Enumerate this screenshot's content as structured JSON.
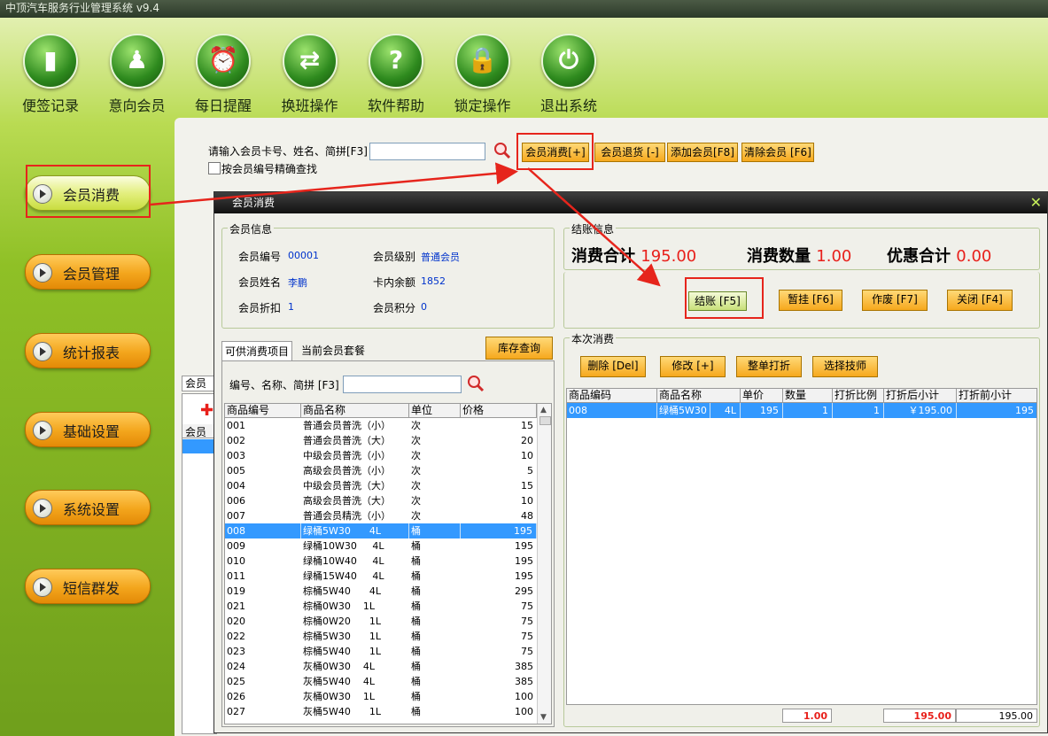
{
  "app_title": "中顶汽车服务行业管理系统 v9.4",
  "toolbar": [
    {
      "label": "便签记录",
      "icon": "note-icon",
      "glyph": "▮"
    },
    {
      "label": "意向会员",
      "icon": "person-icon",
      "glyph": "♟"
    },
    {
      "label": "每日提醒",
      "icon": "alarm-clock-icon",
      "glyph": "⏰"
    },
    {
      "label": "换班操作",
      "icon": "swap-arrows-icon",
      "glyph": "⇄"
    },
    {
      "label": "软件帮助",
      "icon": "help-icon",
      "glyph": "?"
    },
    {
      "label": "锁定操作",
      "icon": "lock-icon",
      "glyph": "🔒"
    },
    {
      "label": "退出系统",
      "icon": "power-icon",
      "glyph": "⏻"
    }
  ],
  "sidebar": [
    {
      "label": "会员消费",
      "active": true
    },
    {
      "label": "会员管理"
    },
    {
      "label": "统计报表"
    },
    {
      "label": "基础设置"
    },
    {
      "label": "系统设置"
    },
    {
      "label": "短信群发"
    }
  ],
  "search": {
    "prompt": "请输入会员卡号、姓名、简拼[F3]",
    "value": "",
    "exact_label": "按会员编号精确查找",
    "buttons": [
      "会员消费[+]",
      "会员退货 [-]",
      "添加会员[F8]",
      "清除会员 [F6]"
    ]
  },
  "behind": {
    "tab": "会员",
    "col": "会员编"
  },
  "dialog": {
    "title": "会员消费",
    "member_group": "会员信息",
    "member": {
      "id_label": "会员编号",
      "id": "00001",
      "level_label": "会员级别",
      "level": "普通会员",
      "name_label": "会员姓名",
      "name": "李鹏",
      "balance_label": "卡内余额",
      "balance": "1852",
      "discount_label": "会员折扣",
      "discount": "1",
      "points_label": "会员积分",
      "points": "0"
    },
    "checkout_group": "结账信息",
    "totals": {
      "total_label": "消费合计",
      "total": "195.00",
      "qty_label": "消费数量",
      "qty": "1.00",
      "discount_label": "优惠合计",
      "discount": "0.00"
    },
    "checkout_buttons": [
      "结账 [F5]",
      "暂挂 [F6]",
      "作废 [F7]",
      "关闭 [F4]"
    ],
    "tabs": [
      "可供消费项目",
      "当前会员套餐"
    ],
    "stock_button": "库存查询",
    "product_search_label": "编号、名称、简拼 [F3]",
    "product_columns": [
      "商品编号",
      "商品名称",
      "单位",
      "价格"
    ],
    "products": [
      {
        "code": "001",
        "name": "普通会员普洗（小）",
        "unit": "次",
        "price": "15"
      },
      {
        "code": "002",
        "name": "普通会员普洗（大）",
        "unit": "次",
        "price": "20"
      },
      {
        "code": "003",
        "name": "中级会员普洗（小）",
        "unit": "次",
        "price": "10"
      },
      {
        "code": "005",
        "name": "高级会员普洗（小）",
        "unit": "次",
        "price": "5"
      },
      {
        "code": "004",
        "name": "中级会员普洗（大）",
        "unit": "次",
        "price": "15"
      },
      {
        "code": "006",
        "name": "高级会员普洗（大）",
        "unit": "次",
        "price": "10"
      },
      {
        "code": "007",
        "name": "普通会员精洗（小）",
        "unit": "次",
        "price": "48"
      },
      {
        "code": "008",
        "name": "绿桶5W30      4L",
        "unit": "桶",
        "price": "195",
        "selected": true
      },
      {
        "code": "009",
        "name": "绿桶10W30     4L",
        "unit": "桶",
        "price": "195"
      },
      {
        "code": "010",
        "name": "绿桶10W40     4L",
        "unit": "桶",
        "price": "195"
      },
      {
        "code": "011",
        "name": "绿桶15W40     4L",
        "unit": "桶",
        "price": "195"
      },
      {
        "code": "019",
        "name": "棕桶5W40      4L",
        "unit": "桶",
        "price": "295"
      },
      {
        "code": "021",
        "name": "棕桶0W30    1L",
        "unit": "桶",
        "price": "75"
      },
      {
        "code": "020",
        "name": "棕桶0W20      1L",
        "unit": "桶",
        "price": "75"
      },
      {
        "code": "022",
        "name": "棕桶5W30      1L",
        "unit": "桶",
        "price": "75"
      },
      {
        "code": "023",
        "name": "棕桶5W40      1L",
        "unit": "桶",
        "price": "75"
      },
      {
        "code": "024",
        "name": "灰桶0W30    4L",
        "unit": "桶",
        "price": "385"
      },
      {
        "code": "025",
        "name": "灰桶5W40    4L",
        "unit": "桶",
        "price": "385"
      },
      {
        "code": "026",
        "name": "灰桶0W30    1L",
        "unit": "桶",
        "price": "100"
      },
      {
        "code": "027",
        "name": "灰桶5W40      1L",
        "unit": "桶",
        "price": "100"
      }
    ],
    "current_group": "本次消费",
    "current_buttons": [
      "删除 [Del]",
      "修改 [+]",
      "整单打折",
      "选择技师"
    ],
    "current_columns": [
      "商品编码",
      "商品名称",
      "单价",
      "数量",
      "打折比例",
      "打折后小计",
      "打折前小计"
    ],
    "current_rows": [
      {
        "code": "008",
        "name": "绿桶5W30",
        "spec": "4L",
        "price": "195",
        "qty": "1",
        "ratio": "1",
        "after": "￥195.00",
        "before": "195"
      }
    ],
    "footer": {
      "qty": "1.00",
      "after": "195.00",
      "before": "195.00"
    }
  },
  "colors": {
    "annotation_red": "#e6251c",
    "selection_blue": "#3399ff"
  }
}
